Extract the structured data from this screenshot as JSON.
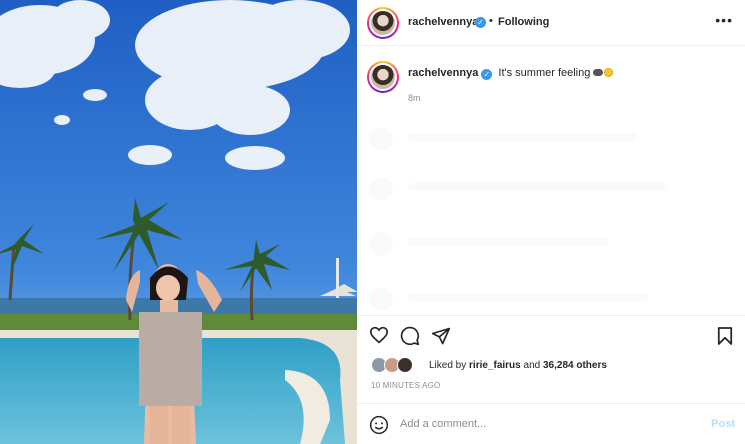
{
  "post": {
    "username": "rachelvennya",
    "verified_glyph": "✓",
    "separator": "•",
    "follow_status": "Following",
    "more_icon": "more-horizontal-icon",
    "caption": "It's summer feeling",
    "caption_time": "8m",
    "likes_prefix": "Liked by",
    "liked_by_user": "ririe_fairus",
    "likes_and": "and",
    "likes_others": "36,284 others",
    "timestamp": "10 MINUTES AGO",
    "comment_placeholder": "Add a comment...",
    "post_label": "Post"
  },
  "colors": {
    "sky": "#2f6fd0",
    "pool": "#3aa0c8",
    "verified": "#3897f0",
    "post_disabled": "#b2dffc"
  }
}
